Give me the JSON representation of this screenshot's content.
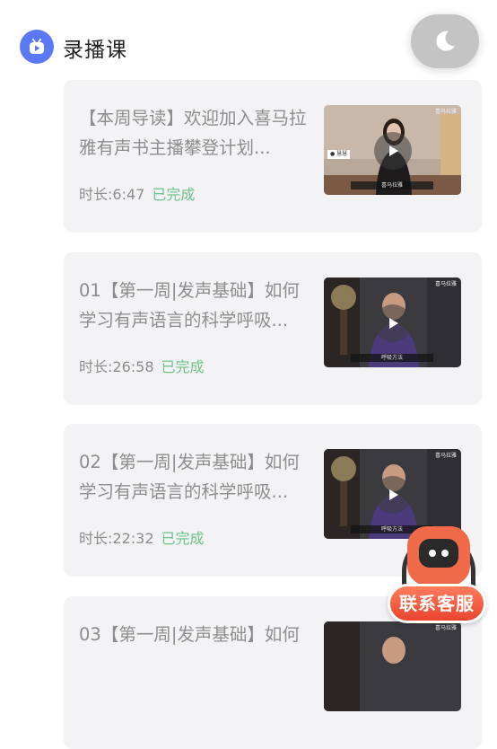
{
  "header": {
    "title": "录播课",
    "section_icon": "tv-icon",
    "night_mode_icon": "moon-icon"
  },
  "lessons": [
    {
      "title": "【本周导读】欢迎加入喜马拉雅有声书主播攀登计划...",
      "duration_label": "时长:6:47",
      "status": "已完成",
      "thumb": {
        "caption": "喜马拉雅",
        "name_tag": "● 慧慧",
        "brand": "喜马拉雅"
      }
    },
    {
      "title": "01【第一周|发声基础】如何学习有声语言的科学呼吸...",
      "duration_label": "时长:26:58",
      "status": "已完成",
      "thumb": {
        "caption": "呼吸方法",
        "brand": "喜马拉雅"
      }
    },
    {
      "title": "02【第一周|发声基础】如何学习有声语言的科学呼吸...",
      "duration_label": "时长:22:32",
      "status": "已完成",
      "thumb": {
        "caption": "呼吸方法",
        "brand": "喜马拉雅"
      }
    },
    {
      "title": "03【第一周|发声基础】如何",
      "duration_label": "",
      "status": "",
      "thumb": {
        "caption": "",
        "brand": "喜马拉雅"
      }
    }
  ],
  "support": {
    "label": "联系客服",
    "icon": "robot-support-icon"
  },
  "colors": {
    "accent_blue": "#5b78f6",
    "done_green": "#6cc28a",
    "card_bg": "#f3f3f5",
    "support_red": "#e8452e"
  }
}
